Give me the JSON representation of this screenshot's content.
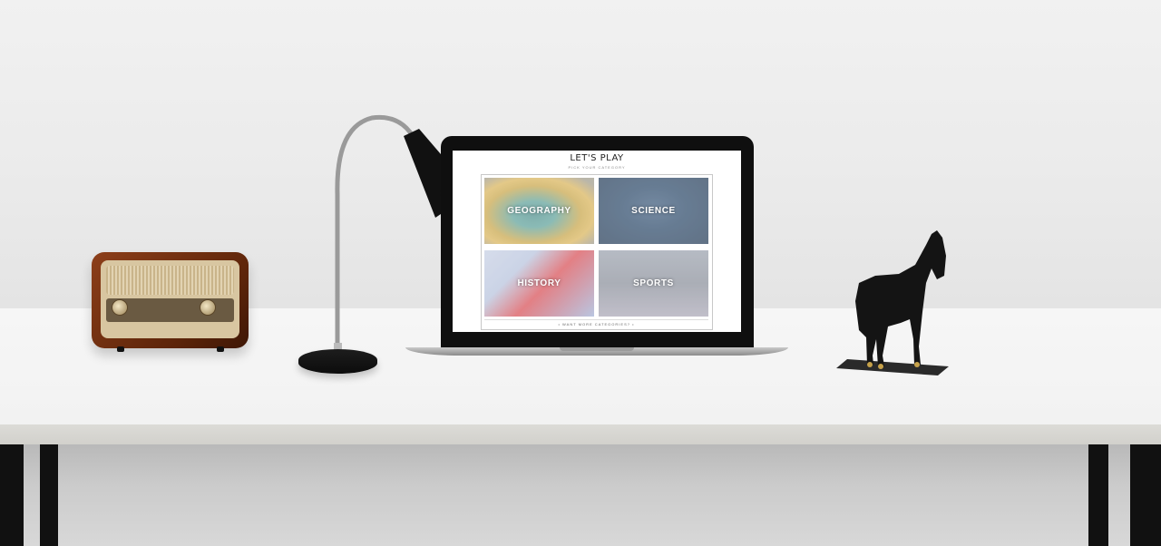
{
  "screen": {
    "title": "LET'S PLAY",
    "subtitle": "PICK YOUR CATEGORY",
    "categories": [
      {
        "label": "GEOGRAPHY"
      },
      {
        "label": "SCIENCE"
      },
      {
        "label": "HISTORY"
      },
      {
        "label": "SPORTS"
      }
    ],
    "more_label": "• WANT MORE CATEGORIES? •"
  },
  "scene": {
    "icons": [
      "radio-icon",
      "desk-lamp-icon",
      "laptop-icon",
      "horse-statue-icon"
    ]
  }
}
